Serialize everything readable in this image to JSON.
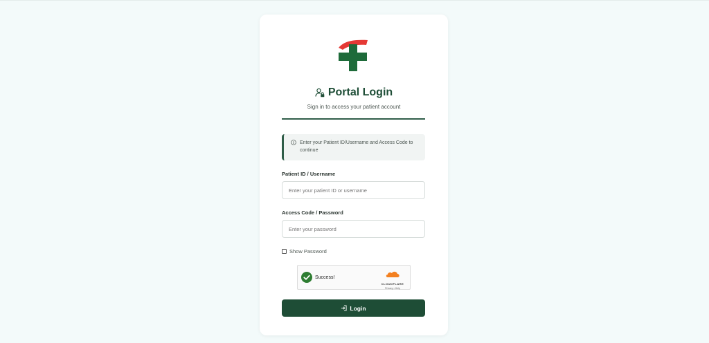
{
  "colors": {
    "brand_green": "#1e4d36",
    "logo_red": "#e53935",
    "success_green": "#2e7d32",
    "cloudflare_orange": "#f38020"
  },
  "header": {
    "title": "Portal Login",
    "title_icon": "user-lock-icon",
    "subtitle": "Sign in to access your patient account"
  },
  "info": {
    "icon": "info-icon",
    "text": "Enter your Patient ID/Username and Access Code to continue"
  },
  "form": {
    "username_label": "Patient ID / Username",
    "username_placeholder": "Enter your patient ID or username",
    "password_label": "Access Code / Password",
    "password_placeholder": "Enter your password",
    "show_password_label": "Show Password",
    "show_password_checked": false
  },
  "captcha": {
    "status": "Success!",
    "brand": "CLOUDFLARE",
    "links": "Privacy • Help"
  },
  "login_button": {
    "label": "Login",
    "icon": "sign-in-icon"
  }
}
